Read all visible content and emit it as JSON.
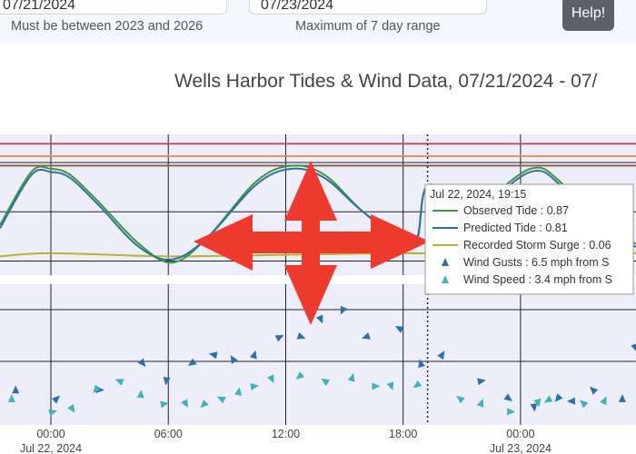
{
  "controls": {
    "start_date": {
      "value": "07/21/2024",
      "hint": "Must be between 2023 and 2026"
    },
    "end_date": {
      "value": "07/23/2024",
      "hint": "Maximum of 7 day range"
    },
    "help_label": "Help!"
  },
  "chart_title": "Wells Harbor Tides & Wind Data, 07/21/2024 - 07/",
  "tooltip": {
    "header": "Jul 22, 2024, 19:15",
    "rows": [
      {
        "label": "Observed Tide : 0.87",
        "color": "#3a9a3a"
      },
      {
        "label": "Predicted Tide : 0.81",
        "color": "#2f6fa8"
      },
      {
        "label": "Recorded Storm Surge : 0.06",
        "color": "#b8b430"
      },
      {
        "label": "Wind Gusts : 6.5 mph from S",
        "color": "#2f6fa8"
      },
      {
        "label": "Wind Speed : 3.4 mph from S",
        "color": "#3fb3b8"
      }
    ]
  },
  "colors": {
    "observed": "#3a9a3a",
    "predicted": "#2f6fa8",
    "surge": "#b8b430",
    "gusts": "#2f6fa8",
    "speed": "#3fb3b8",
    "plot_bg": "#eeeefa",
    "threshold_red": "#c44a4a",
    "threshold_orange": "#e08a4a",
    "threshold_brown": "#8a5a4a",
    "pan_arrows": "#ee3a2e"
  },
  "chart_data": {
    "type": "line",
    "x_ticks": [
      "00:00\nJul 22, 2024",
      "06:00",
      "12:00",
      "18:00",
      "00:00\nJul 23, 2024"
    ],
    "x_tick_labels": [
      "00:00",
      "06:00",
      "12:00",
      "18:00",
      "00:00"
    ],
    "x_tick_dates": [
      "Jul 22, 2024",
      "",
      "",
      "",
      "Jul 23, 2024"
    ],
    "x_hours": [
      0,
      6,
      12,
      18,
      24
    ],
    "xrange_hours": [
      -2.6,
      29.9
    ],
    "hover_hour": 19.25,
    "tide": {
      "thresholds": [
        2.2,
        1.8,
        1.5
      ],
      "observed": [
        [
          -2.6,
          -0.4
        ],
        [
          -1.0,
          1.3
        ],
        [
          0,
          1.4
        ],
        [
          1,
          1.2
        ],
        [
          2.5,
          0.3
        ],
        [
          4.5,
          -1.0
        ],
        [
          6.2,
          -1.6
        ],
        [
          8,
          -0.8
        ],
        [
          10.5,
          1.0
        ],
        [
          12.3,
          1.5
        ],
        [
          14,
          1.2
        ],
        [
          16,
          0.0
        ],
        [
          18.5,
          -1.1
        ],
        [
          19.25,
          0.87
        ],
        [
          21.5,
          0.2
        ],
        [
          24.5,
          1.4
        ],
        [
          26,
          1.0
        ],
        [
          28,
          -0.4
        ],
        [
          29.9,
          -1.0
        ]
      ],
      "predicted": [
        [
          -2.6,
          -0.5
        ],
        [
          -1.0,
          1.2
        ],
        [
          0,
          1.3
        ],
        [
          1,
          1.1
        ],
        [
          2.5,
          0.2
        ],
        [
          4.5,
          -1.1
        ],
        [
          6.2,
          -1.5
        ],
        [
          8,
          -0.8
        ],
        [
          10.5,
          0.9
        ],
        [
          12.3,
          1.4
        ],
        [
          14,
          1.1
        ],
        [
          16,
          0.0
        ],
        [
          18.5,
          -1.0
        ],
        [
          19.25,
          0.81
        ],
        [
          21.5,
          0.1
        ],
        [
          24.5,
          1.3
        ],
        [
          26,
          0.9
        ],
        [
          28,
          -0.5
        ],
        [
          29.9,
          -1.1
        ]
      ],
      "surge": [
        [
          -2.6,
          -1.4
        ],
        [
          0,
          -1.3
        ],
        [
          6,
          -1.4
        ],
        [
          12,
          -1.35
        ],
        [
          18,
          -1.3
        ],
        [
          24,
          -1.35
        ],
        [
          29.9,
          -1.3
        ]
      ],
      "yrange": [
        -2,
        2.5
      ]
    },
    "wind": {
      "yrange": [
        0,
        16
      ],
      "gusts": [
        [
          -1.8,
          4
        ],
        [
          0.3,
          3
        ],
        [
          2.5,
          4
        ],
        [
          4.7,
          7
        ],
        [
          5.9,
          5
        ],
        [
          7.2,
          7
        ],
        [
          8.3,
          8
        ],
        [
          9.3,
          7.5
        ],
        [
          10.4,
          8
        ],
        [
          11.7,
          10
        ],
        [
          12.8,
          10
        ],
        [
          13.8,
          12
        ],
        [
          14.9,
          13
        ],
        [
          16.1,
          10
        ],
        [
          17.8,
          11
        ],
        [
          18.9,
          7
        ],
        [
          20,
          8
        ],
        [
          22,
          5
        ],
        [
          23.4,
          3
        ],
        [
          24.7,
          2
        ],
        [
          25.9,
          3
        ],
        [
          26.6,
          2.7
        ],
        [
          27.7,
          4
        ],
        [
          29.2,
          3
        ],
        [
          29.9,
          9
        ]
      ],
      "speed": [
        [
          -2.0,
          3
        ],
        [
          0.1,
          1.5
        ],
        [
          1.1,
          1.8
        ],
        [
          2.3,
          4
        ],
        [
          3.5,
          5
        ],
        [
          4.6,
          3.5
        ],
        [
          5.8,
          2.4
        ],
        [
          6.9,
          2.4
        ],
        [
          7.8,
          2.3
        ],
        [
          8.7,
          3
        ],
        [
          9.6,
          3.8
        ],
        [
          10.4,
          4.4
        ],
        [
          11.3,
          5.2
        ],
        [
          12.7,
          5.5
        ],
        [
          14.0,
          5.0
        ],
        [
          15.4,
          5.4
        ],
        [
          16.6,
          4.4
        ],
        [
          17.4,
          4.4
        ],
        [
          18.7,
          4.5
        ],
        [
          20.9,
          3.0
        ],
        [
          22.0,
          2.5
        ],
        [
          23.5,
          1.5
        ],
        [
          24.9,
          2.5
        ],
        [
          25.4,
          2.8
        ],
        [
          27.2,
          2.5
        ],
        [
          28.3,
          2.8
        ]
      ]
    }
  }
}
